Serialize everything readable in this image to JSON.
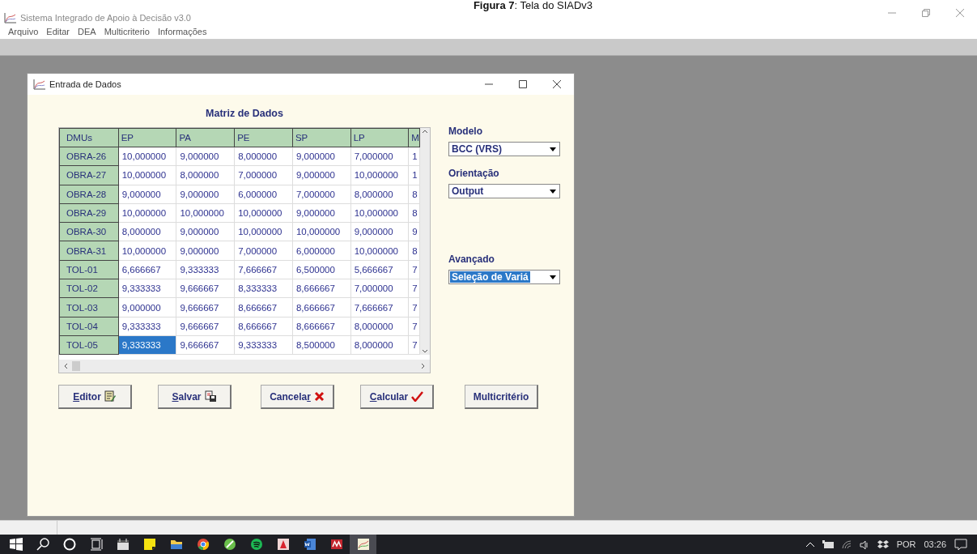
{
  "caption": "**Figura 7**: Tela do SIADv3",
  "app_window": {
    "title": "Sistema Integrado de Apoio à Decisão v3.0"
  },
  "menu": [
    "Arquivo",
    "Editar",
    "DEA",
    "Multicriterio",
    "Informações"
  ],
  "dialog": {
    "title": "Entrada de Dados",
    "table_title": "Matriz de Dados",
    "columns": [
      "DMUs",
      "EP",
      "PA",
      "PE",
      "SP",
      "LP",
      "M"
    ],
    "rows": [
      {
        "cells": [
          {
            "text": "OBRA-26",
            "selected": false
          },
          {
            "text": "10,000000",
            "selected": false
          },
          {
            "text": "9,000000",
            "selected": false
          },
          {
            "text": "8,000000",
            "selected": false
          },
          {
            "text": "9,000000",
            "selected": false
          },
          {
            "text": "7,000000",
            "selected": false
          },
          {
            "text": "1",
            "selected": false
          }
        ]
      },
      {
        "cells": [
          {
            "text": "OBRA-27",
            "selected": false
          },
          {
            "text": "10,000000",
            "selected": false
          },
          {
            "text": "8,000000",
            "selected": false
          },
          {
            "text": "7,000000",
            "selected": false
          },
          {
            "text": "9,000000",
            "selected": false
          },
          {
            "text": "10,000000",
            "selected": false
          },
          {
            "text": "1",
            "selected": false
          }
        ]
      },
      {
        "cells": [
          {
            "text": "OBRA-28",
            "selected": false
          },
          {
            "text": "9,000000",
            "selected": false
          },
          {
            "text": "9,000000",
            "selected": false
          },
          {
            "text": "6,000000",
            "selected": false
          },
          {
            "text": "7,000000",
            "selected": false
          },
          {
            "text": "8,000000",
            "selected": false
          },
          {
            "text": "8",
            "selected": false
          }
        ]
      },
      {
        "cells": [
          {
            "text": "OBRA-29",
            "selected": false
          },
          {
            "text": "10,000000",
            "selected": false
          },
          {
            "text": "10,000000",
            "selected": false
          },
          {
            "text": "10,000000",
            "selected": false
          },
          {
            "text": "9,000000",
            "selected": false
          },
          {
            "text": "10,000000",
            "selected": false
          },
          {
            "text": "8",
            "selected": false
          }
        ]
      },
      {
        "cells": [
          {
            "text": "OBRA-30",
            "selected": false
          },
          {
            "text": "8,000000",
            "selected": false
          },
          {
            "text": "9,000000",
            "selected": false
          },
          {
            "text": "10,000000",
            "selected": false
          },
          {
            "text": "10,000000",
            "selected": false
          },
          {
            "text": "9,000000",
            "selected": false
          },
          {
            "text": "9",
            "selected": false
          }
        ]
      },
      {
        "cells": [
          {
            "text": "OBRA-31",
            "selected": false
          },
          {
            "text": "10,000000",
            "selected": false
          },
          {
            "text": "9,000000",
            "selected": false
          },
          {
            "text": "7,000000",
            "selected": false
          },
          {
            "text": "6,000000",
            "selected": false
          },
          {
            "text": "10,000000",
            "selected": false
          },
          {
            "text": "8",
            "selected": false
          }
        ]
      },
      {
        "cells": [
          {
            "text": "TOL-01",
            "selected": false
          },
          {
            "text": "6,666667",
            "selected": false
          },
          {
            "text": "9,333333",
            "selected": false
          },
          {
            "text": "7,666667",
            "selected": false
          },
          {
            "text": "6,500000",
            "selected": false
          },
          {
            "text": "5,666667",
            "selected": false
          },
          {
            "text": "7",
            "selected": false
          }
        ]
      },
      {
        "cells": [
          {
            "text": "TOL-02",
            "selected": false
          },
          {
            "text": "9,333333",
            "selected": false
          },
          {
            "text": "9,666667",
            "selected": false
          },
          {
            "text": "8,333333",
            "selected": false
          },
          {
            "text": "8,666667",
            "selected": false
          },
          {
            "text": "7,000000",
            "selected": false
          },
          {
            "text": "7",
            "selected": false
          }
        ]
      },
      {
        "cells": [
          {
            "text": "TOL-03",
            "selected": false
          },
          {
            "text": "9,000000",
            "selected": false
          },
          {
            "text": "9,666667",
            "selected": false
          },
          {
            "text": "8,666667",
            "selected": false
          },
          {
            "text": "8,666667",
            "selected": false
          },
          {
            "text": "7,666667",
            "selected": false
          },
          {
            "text": "7",
            "selected": false
          }
        ]
      },
      {
        "cells": [
          {
            "text": "TOL-04",
            "selected": false
          },
          {
            "text": "9,333333",
            "selected": false
          },
          {
            "text": "9,666667",
            "selected": false
          },
          {
            "text": "8,666667",
            "selected": false
          },
          {
            "text": "8,666667",
            "selected": false
          },
          {
            "text": "8,000000",
            "selected": false
          },
          {
            "text": "7",
            "selected": false
          }
        ]
      },
      {
        "cells": [
          {
            "text": "TOL-05",
            "selected": false
          },
          {
            "text": "9,333333",
            "selected": true
          },
          {
            "text": "9,666667",
            "selected": false
          },
          {
            "text": "9,333333",
            "selected": false
          },
          {
            "text": "8,500000",
            "selected": false
          },
          {
            "text": "8,000000",
            "selected": false
          },
          {
            "text": "7",
            "selected": false
          }
        ]
      }
    ],
    "options": [
      {
        "label": "Modelo",
        "value": "BCC (VRS)",
        "highlighted": false
      },
      {
        "label": "Orientação",
        "value": "Output",
        "highlighted": false
      },
      {
        "label": "Avançado",
        "value": "Seleção de Variá",
        "highlighted": true
      }
    ],
    "buttons": [
      {
        "key": "E",
        "post": "ditor",
        "kind": "editor"
      },
      {
        "key": "S",
        "post": "alvar",
        "kind": "save"
      },
      {
        "pre": "Cancela",
        "key": "r",
        "kind": "cancel"
      },
      {
        "key": "C",
        "post": "alcular",
        "kind": "calculate"
      },
      {
        "pre": "Multicritério",
        "kind": "plain"
      }
    ]
  },
  "taskbar": {
    "apps": [
      {
        "kind": "start",
        "selected": false
      },
      {
        "kind": "search",
        "selected": false
      },
      {
        "kind": "cortana",
        "selected": false
      },
      {
        "kind": "taskview",
        "selected": false
      },
      {
        "kind": "calendar",
        "selected": false
      },
      {
        "kind": "notes",
        "selected": false
      },
      {
        "kind": "folder",
        "selected": false
      },
      {
        "kind": "chrome",
        "selected": false
      },
      {
        "kind": "greenapp",
        "selected": false
      },
      {
        "kind": "spotify",
        "selected": false
      },
      {
        "kind": "redapp",
        "selected": false
      },
      {
        "kind": "word",
        "selected": false
      },
      {
        "kind": "mapp",
        "selected": false
      },
      {
        "kind": "siad",
        "selected": true
      }
    ],
    "language": "POR",
    "time": "03:26"
  }
}
